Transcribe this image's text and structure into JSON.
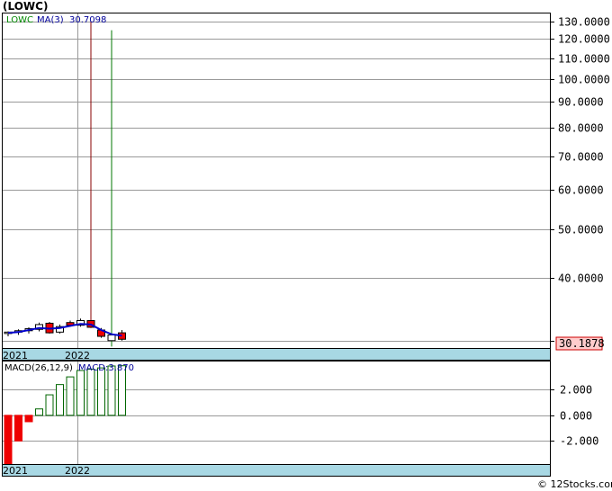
{
  "title": "(LOWC)",
  "watermark": "© 12Stocks.com",
  "chart_data": [
    {
      "type": "candlestick",
      "legend": [
        "LOWC",
        "MA(3)",
        "30.7098"
      ],
      "last_price_label": "30.1878",
      "y_scale": "log",
      "ylim": [
        29,
        135
      ],
      "y_ticks": [
        {
          "value": 130,
          "label": "130.0000"
        },
        {
          "value": 120,
          "label": "120.0000"
        },
        {
          "value": 110,
          "label": "110.0000"
        },
        {
          "value": 100,
          "label": "100.0000"
        },
        {
          "value": 90,
          "label": "90.0000"
        },
        {
          "value": 80,
          "label": "80.0000"
        },
        {
          "value": 70,
          "label": "70.0000"
        },
        {
          "value": 60,
          "label": "60.0000"
        },
        {
          "value": 50,
          "label": "50.0000"
        },
        {
          "value": 40,
          "label": "40.0000"
        },
        {
          "value": 30,
          "label": "30.0000"
        }
      ],
      "x_labels": [
        "2021",
        "2022"
      ],
      "candles": [
        {
          "o": 31.0,
          "h": 31.3,
          "l": 30.6,
          "c": 31.2
        },
        {
          "o": 31.2,
          "h": 31.6,
          "l": 30.8,
          "c": 31.4
        },
        {
          "o": 31.4,
          "h": 31.9,
          "l": 31.0,
          "c": 31.7
        },
        {
          "o": 31.6,
          "h": 32.6,
          "l": 31.3,
          "c": 32.3
        },
        {
          "o": 32.5,
          "h": 32.7,
          "l": 31.0,
          "c": 31.1
        },
        {
          "o": 31.2,
          "h": 32.3,
          "l": 31.0,
          "c": 32.0
        },
        {
          "o": 32.6,
          "h": 32.9,
          "l": 32.0,
          "c": 32.2
        },
        {
          "o": 32.2,
          "h": 33.2,
          "l": 32.0,
          "c": 32.9
        },
        {
          "o": 32.9,
          "h": 130.0,
          "l": 31.8,
          "c": 31.9
        },
        {
          "o": 31.5,
          "h": 31.8,
          "l": 30.4,
          "c": 30.6
        },
        {
          "o": 30.0,
          "h": 125.0,
          "l": 29.2,
          "c": 30.8
        },
        {
          "o": 31.1,
          "h": 31.5,
          "l": 30.0,
          "c": 30.19
        }
      ],
      "ma": [
        31.1,
        31.2,
        31.5,
        31.8,
        31.7,
        31.8,
        32.1,
        32.4,
        32.3,
        31.5,
        30.9,
        30.7
      ]
    },
    {
      "type": "bar",
      "legend": [
        "MACD(26,12,9)",
        "MACD:3.870"
      ],
      "ylim": [
        -3.8,
        4.2
      ],
      "y_ticks": [
        {
          "value": 2,
          "label": "2.000"
        },
        {
          "value": 0,
          "label": "0.000"
        },
        {
          "value": -2,
          "label": "-2.000"
        }
      ],
      "x_labels": [
        "2021",
        "2022"
      ],
      "values": [
        -3.8,
        -2.0,
        -0.5,
        0.5,
        1.6,
        2.4,
        3.0,
        3.5,
        3.6,
        3.7,
        3.85,
        3.87
      ]
    }
  ],
  "colors": {
    "up": "#ffffff",
    "down": "#ee0000",
    "ma": "#0000cc",
    "spike_down": "#880000",
    "spike_up": "#007700",
    "macd_pos": "#006600",
    "macd_neg": "#ee0000",
    "axis_band": "#a8d8e4",
    "grid": "#999999",
    "legend_ticker": "#008800",
    "legend_ma": "#000099",
    "legend_text": "#000000",
    "macd_value": "#000099"
  }
}
